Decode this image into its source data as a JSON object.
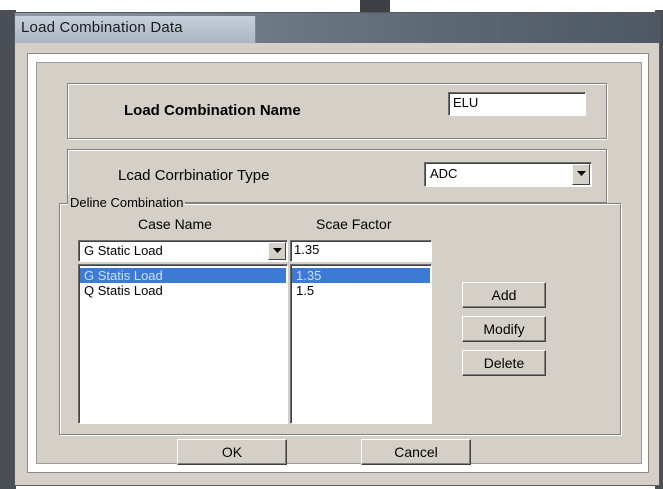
{
  "window": {
    "title": "Load Combination Data"
  },
  "name_group": {
    "label": "Load Combination Name",
    "value": "ELU"
  },
  "type_group": {
    "label": "Lcad Corrbinatior Type",
    "selected": "ADC"
  },
  "define_group": {
    "legend": "Deline Combination",
    "case_name_header": "Case Name",
    "scale_factor_header": "Scae Factor",
    "case_combo_selected": "G Static Load",
    "scale_factor_input": "1.35",
    "rows": [
      {
        "case": "G Statis Load",
        "factor": "1.35",
        "selected": true
      },
      {
        "case": "Q Statis Load",
        "factor": "1.5",
        "selected": false
      }
    ],
    "buttons": {
      "add": "Add",
      "modify": "Modify",
      "delete": "Delete"
    }
  },
  "footer": {
    "ok": "OK",
    "cancel": "Cancel"
  },
  "icons": {
    "dropdown": "chevron-down-icon"
  },
  "colors": {
    "selection": "#3d7ad6",
    "dialog": "#d4d0c8"
  }
}
